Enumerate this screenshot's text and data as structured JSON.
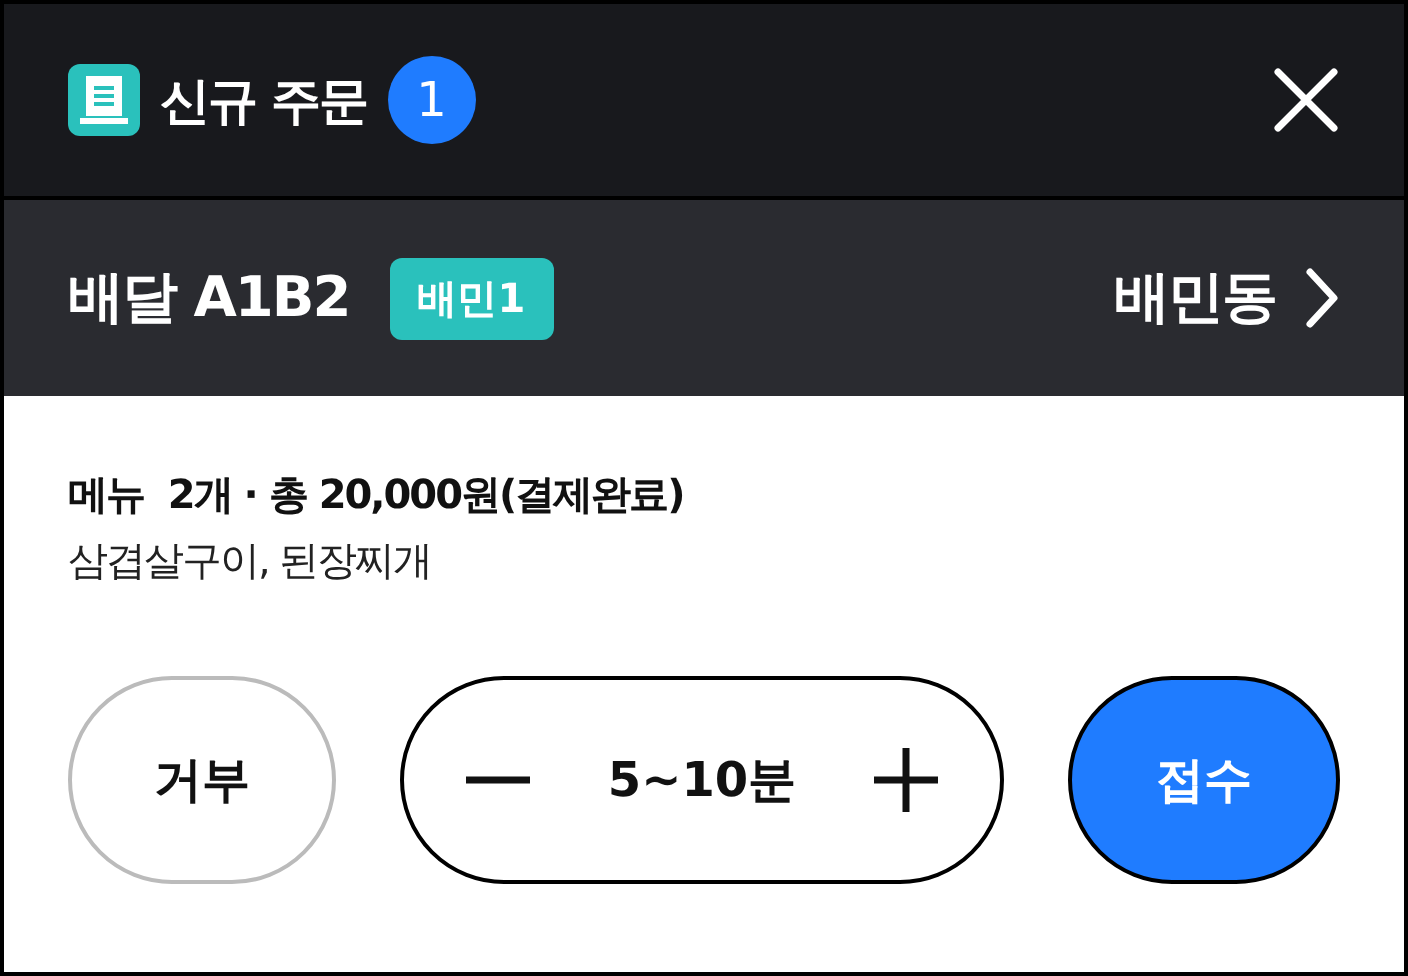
{
  "header": {
    "title": "신규 주문",
    "count": "1"
  },
  "order": {
    "label": "배달 A1B2",
    "tag": "배민1",
    "store": "배민동"
  },
  "summary": "메뉴  2개 · 총 20,000원(결제완료)",
  "items": "삼겹살구이, 된장찌개",
  "actions": {
    "reject": "거부",
    "time": "5~10분",
    "accept": "접수"
  }
}
